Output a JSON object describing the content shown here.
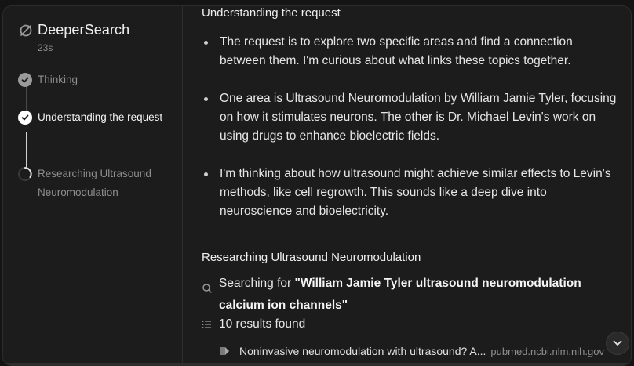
{
  "brand": {
    "name": "DeeperSearch",
    "elapsed": "23s"
  },
  "steps": [
    {
      "label": "Thinking",
      "state": "done"
    },
    {
      "label": "Understanding the request",
      "state": "active"
    },
    {
      "label": "Researching Ultrasound Neuromodulation",
      "state": "pending"
    }
  ],
  "main": {
    "section1_title": "Understanding the request",
    "bullets": [
      "The request is to explore two specific areas and find a connection between them. I'm curious about what links these topics together.",
      "One area is Ultrasound Neuromodulation by William Jamie Tyler, focusing on how it stimulates neurons. The other is Dr. Michael Levin's work on using drugs to enhance bioelectric fields.",
      "I'm thinking about how ultrasound might achieve similar effects to Levin's methods, like cell regrowth. This sounds like a deep dive into neuroscience and bioelectricity."
    ],
    "section2_title": "Researching Ultrasound Neuromodulation",
    "search_prefix": "Searching for ",
    "search_query": "\"William Jamie Tyler ultrasound neuromodulation calcium ion channels\"",
    "results_count": "10 results found",
    "source": {
      "title": "Noninvasive neuromodulation with ultrasound? A...",
      "domain": "pubmed.ncbi.nlm.nih.gov"
    }
  },
  "icons": {
    "brand": "deepersearch-logo-icon",
    "search": "search-icon",
    "results": "list-icon",
    "source": "source-favicon-icon",
    "scroll": "chevron-down-icon"
  }
}
